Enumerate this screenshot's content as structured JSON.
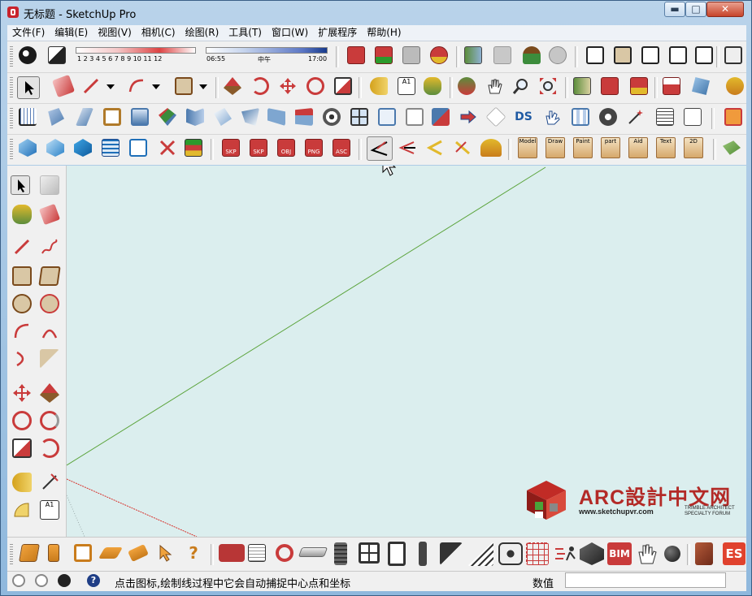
{
  "window": {
    "title": "无标题 - SketchUp Pro",
    "minimize_glyph": "▬",
    "maximize_glyph": "□",
    "close_glyph": "✕"
  },
  "menubar": {
    "items": [
      {
        "label": "文件(F)"
      },
      {
        "label": "编辑(E)"
      },
      {
        "label": "视图(V)"
      },
      {
        "label": "相机(C)"
      },
      {
        "label": "绘图(R)"
      },
      {
        "label": "工具(T)"
      },
      {
        "label": "窗口(W)"
      },
      {
        "label": "扩展程序"
      },
      {
        "label": "帮助(H)"
      }
    ]
  },
  "shadow_toolbar": {
    "month_ticks": "1 2 3 4 5 6 7 8 9 10 11 12",
    "time_start": "06:55",
    "time_noon": "中午",
    "time_end": "17:00"
  },
  "plugin_text_buttons": [
    {
      "label": "Model"
    },
    {
      "label": "Draw"
    },
    {
      "label": "Paint"
    },
    {
      "label": "part"
    },
    {
      "label": "Aid"
    },
    {
      "label": "Text"
    },
    {
      "label": "2D"
    }
  ],
  "file_export_buttons": [
    {
      "label": "SKP"
    },
    {
      "label": "SKP"
    },
    {
      "label": "OBJ"
    },
    {
      "label": "PNG"
    },
    {
      "label": "ASC"
    }
  ],
  "misc_labels": {
    "ds_label": "DS",
    "text_tool_label": "A1",
    "bim_label": "BIM",
    "es_label": "ES"
  },
  "logo": {
    "text": "ARC設計中文网",
    "url": "www.sketchupvr.com",
    "forum": "TRIMBLE ARCHITECT SPECIALTY FORUM"
  },
  "statusbar": {
    "hint": "点击图标,绘制线过程中它会自动捕捉中心点和坐标",
    "measurements_label": "数值",
    "measurements_value": ""
  },
  "colors": {
    "canvas_bg": "#dbeeee",
    "green_axis": "#5aa33a",
    "red_axis": "#d8312b",
    "brand_red": "#b32a27"
  }
}
